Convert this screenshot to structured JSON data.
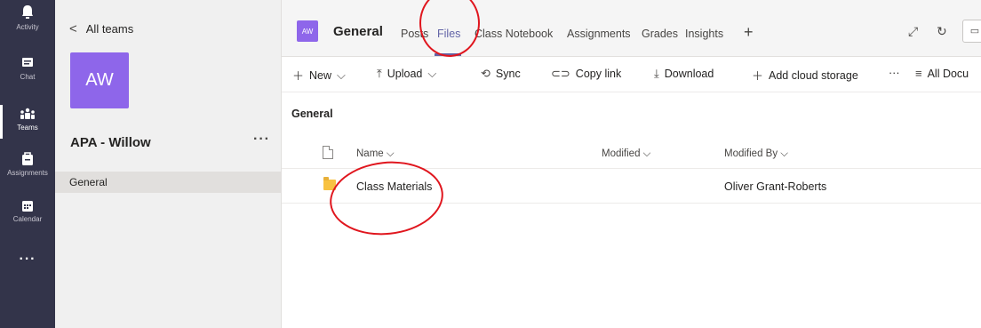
{
  "rail": {
    "items": [
      {
        "label": "Activity",
        "icon": "bell-icon"
      },
      {
        "label": "Chat",
        "icon": "chat-icon"
      },
      {
        "label": "Teams",
        "icon": "teams-icon"
      },
      {
        "label": "Assignments",
        "icon": "assignments-icon"
      },
      {
        "label": "Calendar",
        "icon": "calendar-icon"
      }
    ],
    "more": "···",
    "active": "Teams"
  },
  "team_panel": {
    "back_label": "All teams",
    "avatar_initials": "AW",
    "team_name": "APA - Willow",
    "more": "···",
    "channels": [
      {
        "label": "General"
      }
    ]
  },
  "header": {
    "avatar_initials": "AW",
    "title": "General",
    "tabs": [
      "Posts",
      "Files",
      "Class Notebook",
      "Assignments",
      "Grades",
      "Insights"
    ],
    "active_tab": "Files",
    "add_tab": "+"
  },
  "toolbar": {
    "new": "New",
    "upload": "Upload",
    "sync": "Sync",
    "copy_link": "Copy link",
    "download": "Download",
    "add_cloud": "Add cloud storage",
    "more": "···",
    "all_docs": "All Docu"
  },
  "files": {
    "folder_title": "General",
    "columns": {
      "name": "Name",
      "modified": "Modified",
      "modified_by": "Modified By"
    },
    "rows": [
      {
        "name": "Class Materials",
        "modified": "",
        "modified_by": "Oliver Grant-Roberts",
        "type": "folder"
      }
    ]
  },
  "colors": {
    "accent": "#6264a7",
    "avatar": "#8e66ea",
    "rail": "#33344a",
    "annotation": "#e0161e"
  }
}
